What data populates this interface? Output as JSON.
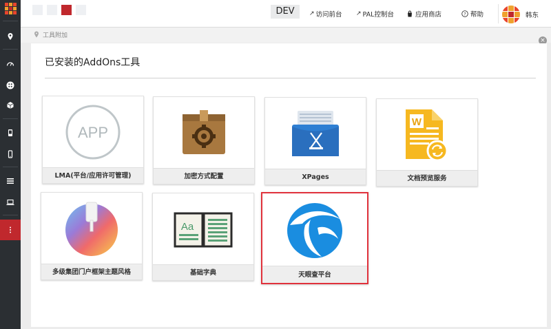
{
  "topbar": {
    "env_badge": "DEV",
    "links": [
      {
        "label": "访问前台"
      },
      {
        "label": "PAL控制台"
      },
      {
        "label": "应用商店"
      },
      {
        "label": "帮助"
      }
    ],
    "user_name": "韩东"
  },
  "breadcrumb": {
    "text": "工具附加"
  },
  "panel": {
    "title": "已安装的AddOns工具"
  },
  "tools": [
    {
      "name": "LMA(平台/应用许可管理)",
      "icon_text": "APP"
    },
    {
      "name": "加密方式配置"
    },
    {
      "name": "XPages"
    },
    {
      "name": "文档预览服务",
      "icon_text": "W"
    },
    {
      "name": "多级集团门户框架主题风格"
    },
    {
      "name": "基础字典",
      "icon_text": "Aa"
    },
    {
      "name": "天眼查平台",
      "selected": true
    }
  ],
  "colors": {
    "accent": "#c0282d",
    "sidebar": "#2b2f33",
    "selected_border": "#e0313b"
  }
}
